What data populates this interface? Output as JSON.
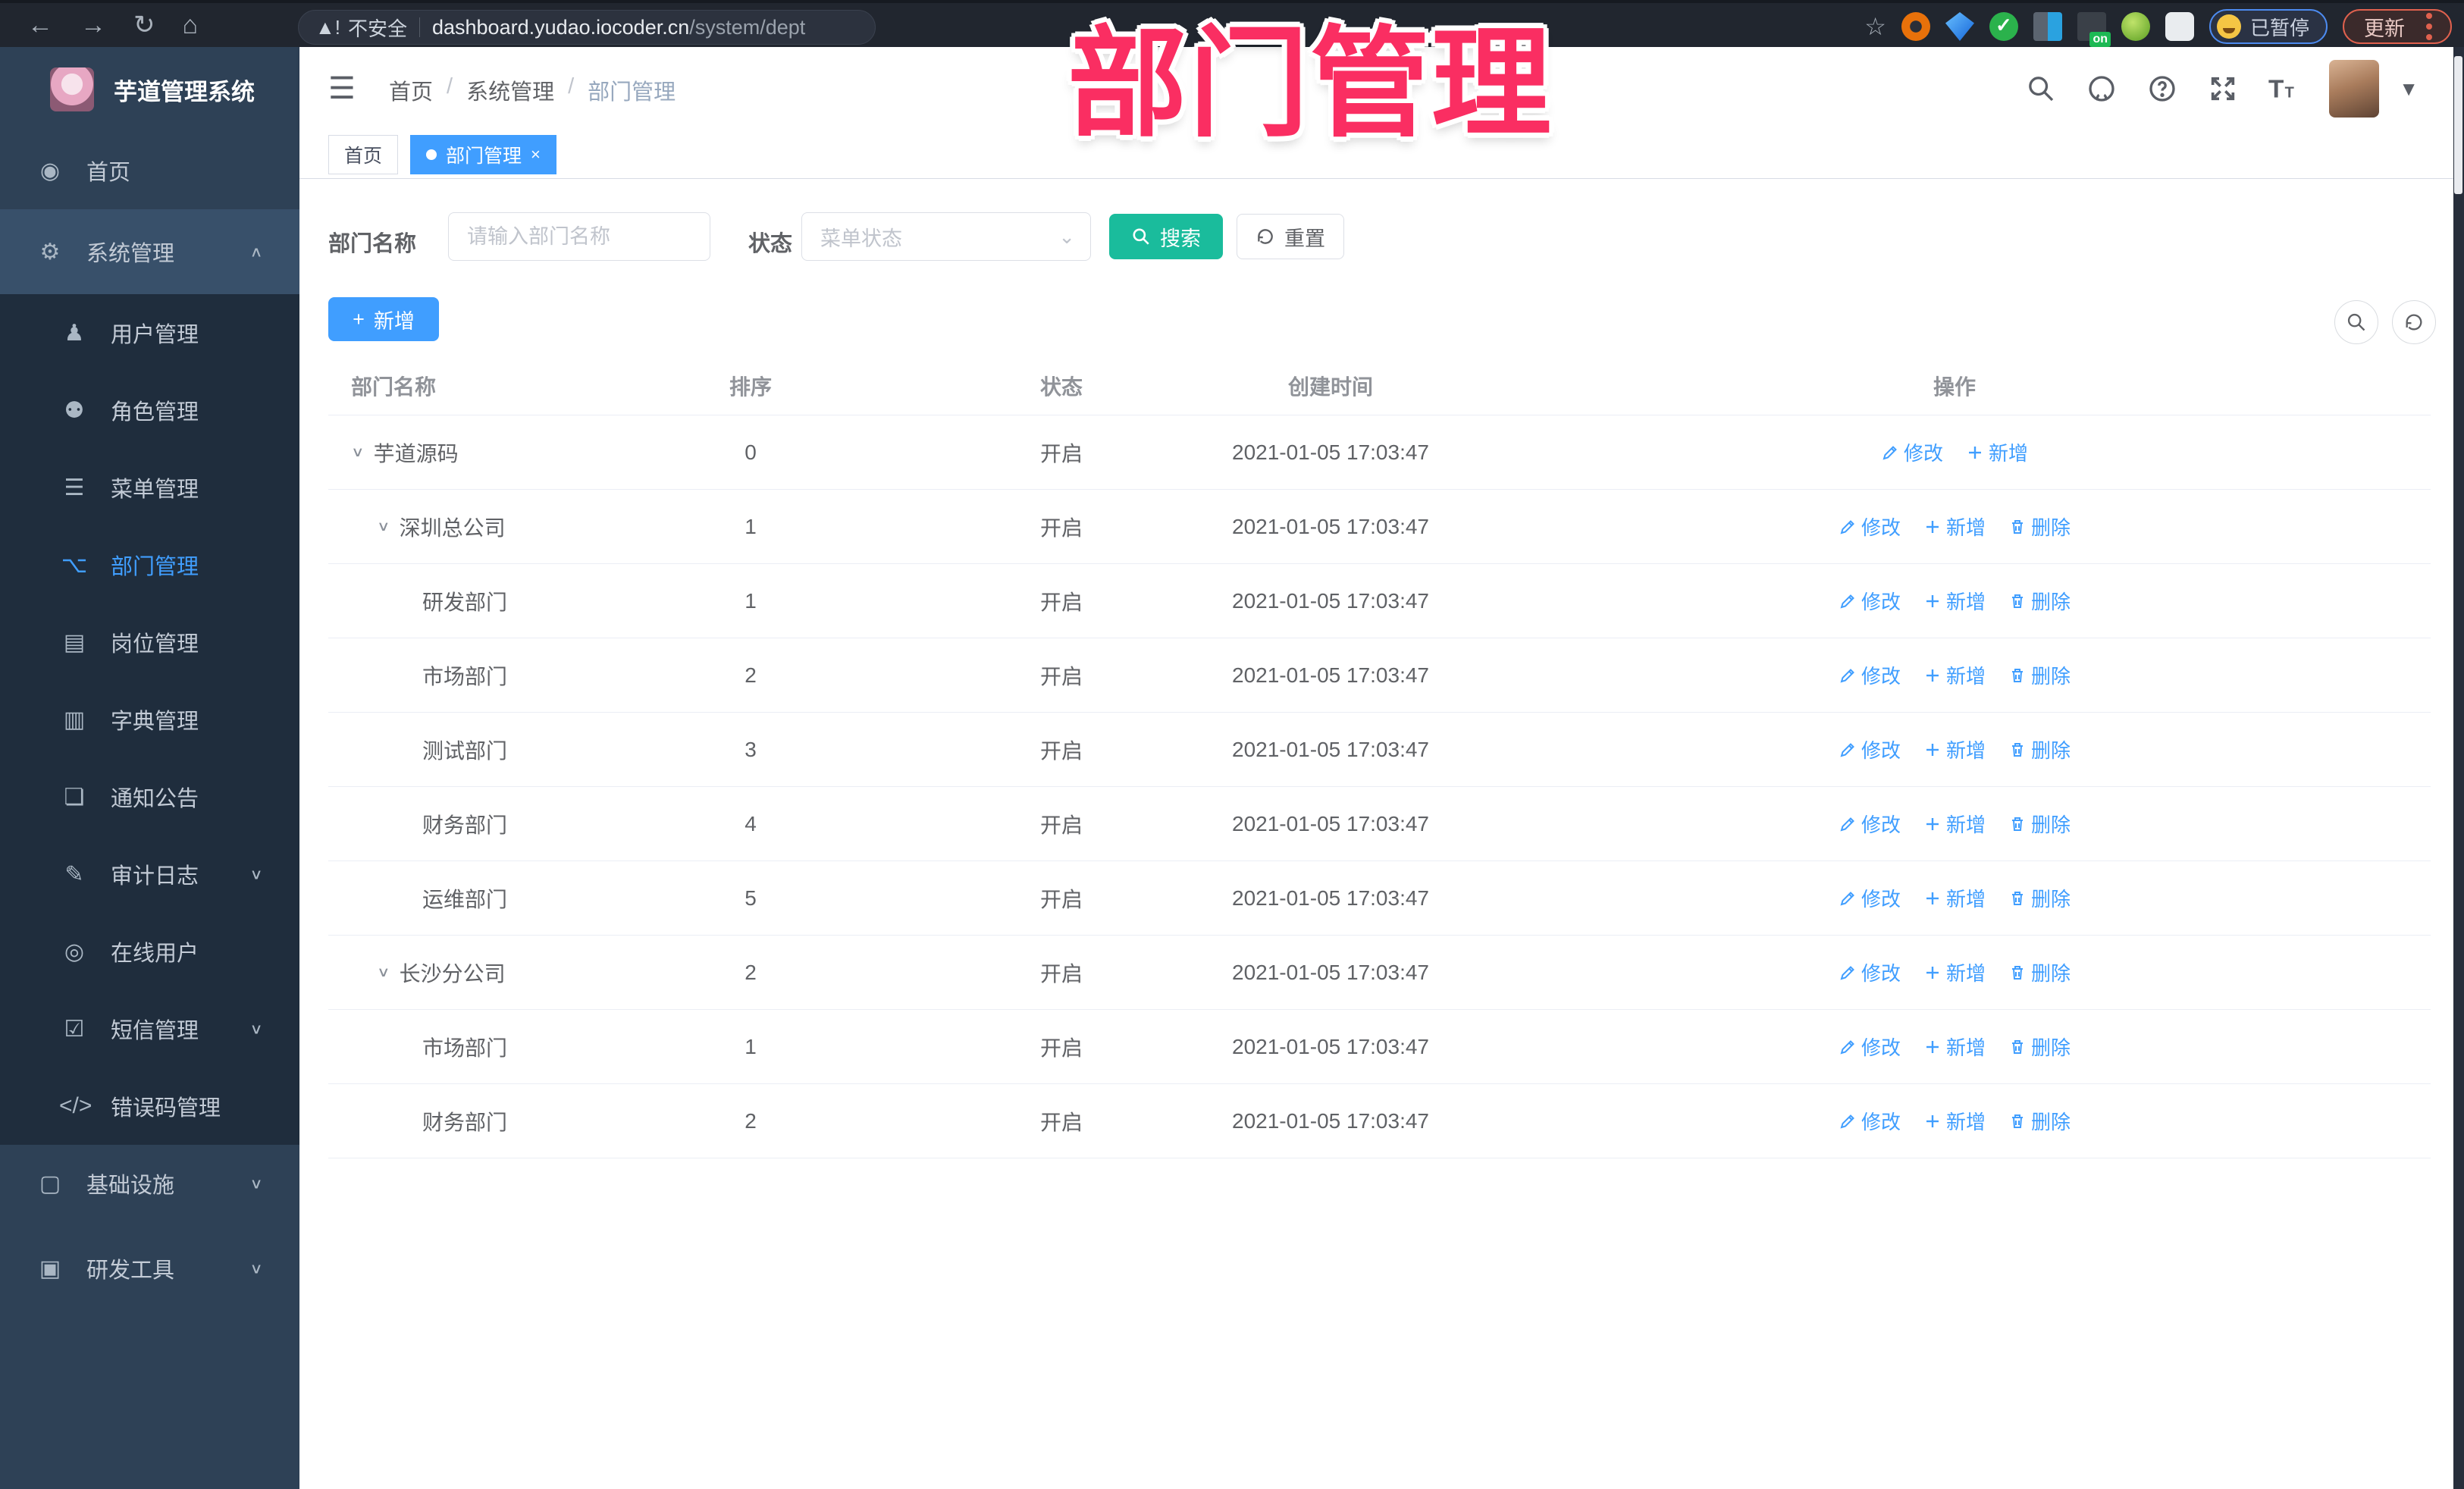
{
  "browser": {
    "back": "←",
    "forward": "→",
    "reload": "↻",
    "home": "⌂",
    "security_label": "不安全",
    "url_host": "dashboard.yudao.iocoder.cn",
    "url_path": "/system/dept",
    "star": "☆",
    "extension_badge": "on",
    "paused_label": "已暂停",
    "update_label": "更新"
  },
  "overlay_title": "部门管理",
  "sidebar": {
    "logo_title": "芋道管理系统",
    "items": [
      {
        "label": "首页",
        "icon": "dashboard-icon",
        "glyph": "◉",
        "kind": "top"
      },
      {
        "label": "系统管理",
        "icon": "gear-icon",
        "glyph": "⚙",
        "kind": "band",
        "chevron": "up"
      },
      {
        "label": "用户管理",
        "icon": "user-icon",
        "glyph": "♟",
        "kind": "sub"
      },
      {
        "label": "角色管理",
        "icon": "roles-icon",
        "glyph": "⚉",
        "kind": "sub"
      },
      {
        "label": "菜单管理",
        "icon": "menu-list-icon",
        "glyph": "☰",
        "kind": "sub"
      },
      {
        "label": "部门管理",
        "icon": "org-tree-icon",
        "glyph": "⌥",
        "kind": "sub",
        "active": true
      },
      {
        "label": "岗位管理",
        "icon": "post-icon",
        "glyph": "▤",
        "kind": "sub"
      },
      {
        "label": "字典管理",
        "icon": "dictionary-icon",
        "glyph": "▥",
        "kind": "sub"
      },
      {
        "label": "通知公告",
        "icon": "announcement-icon",
        "glyph": "❏",
        "kind": "sub"
      },
      {
        "label": "审计日志",
        "icon": "audit-log-icon",
        "glyph": "✎",
        "kind": "sub",
        "chevron": "down"
      },
      {
        "label": "在线用户",
        "icon": "online-users-icon",
        "glyph": "◎",
        "kind": "sub"
      },
      {
        "label": "短信管理",
        "icon": "sms-icon",
        "glyph": "☑",
        "kind": "sub",
        "chevron": "down"
      },
      {
        "label": "错误码管理",
        "icon": "error-code-icon",
        "glyph": "</>",
        "kind": "sub"
      },
      {
        "label": "基础设施",
        "icon": "infrastructure-icon",
        "glyph": "▢",
        "kind": "top",
        "chevron": "down"
      },
      {
        "label": "研发工具",
        "icon": "dev-tools-icon",
        "glyph": "▣",
        "kind": "top",
        "chevron": "down",
        "gap": true
      }
    ]
  },
  "header": {
    "breadcrumb": [
      "首页",
      "系统管理",
      "部门管理"
    ],
    "separator": "/"
  },
  "tags": [
    {
      "label": "首页",
      "active": false,
      "closable": false
    },
    {
      "label": "部门管理",
      "active": true,
      "closable": true
    }
  ],
  "filter": {
    "name_label": "部门名称",
    "name_placeholder": "请输入部门名称",
    "status_label": "状态",
    "status_placeholder": "菜单状态",
    "search_label": "搜索",
    "reset_label": "重置"
  },
  "toolbar": {
    "add_label": "新增"
  },
  "table": {
    "columns": [
      "部门名称",
      "排序",
      "状态",
      "创建时间",
      "操作"
    ],
    "action_labels": {
      "edit": "修改",
      "add": "新增",
      "delete": "删除"
    },
    "rows": [
      {
        "name": "芋道源码",
        "indent": 0,
        "expandable": true,
        "order": "0",
        "status": "开启",
        "created": "2021-01-05 17:03:47",
        "can_delete": false
      },
      {
        "name": "深圳总公司",
        "indent": 1,
        "expandable": true,
        "order": "1",
        "status": "开启",
        "created": "2021-01-05 17:03:47",
        "can_delete": true
      },
      {
        "name": "研发部门",
        "indent": 2,
        "expandable": false,
        "order": "1",
        "status": "开启",
        "created": "2021-01-05 17:03:47",
        "can_delete": true
      },
      {
        "name": "市场部门",
        "indent": 2,
        "expandable": false,
        "order": "2",
        "status": "开启",
        "created": "2021-01-05 17:03:47",
        "can_delete": true
      },
      {
        "name": "测试部门",
        "indent": 2,
        "expandable": false,
        "order": "3",
        "status": "开启",
        "created": "2021-01-05 17:03:47",
        "can_delete": true
      },
      {
        "name": "财务部门",
        "indent": 2,
        "expandable": false,
        "order": "4",
        "status": "开启",
        "created": "2021-01-05 17:03:47",
        "can_delete": true
      },
      {
        "name": "运维部门",
        "indent": 2,
        "expandable": false,
        "order": "5",
        "status": "开启",
        "created": "2021-01-05 17:03:47",
        "can_delete": true
      },
      {
        "name": "长沙分公司",
        "indent": 1,
        "expandable": true,
        "order": "2",
        "status": "开启",
        "created": "2021-01-05 17:03:47",
        "can_delete": true
      },
      {
        "name": "市场部门",
        "indent": 2,
        "expandable": false,
        "order": "1",
        "status": "开启",
        "created": "2021-01-05 17:03:47",
        "can_delete": true
      },
      {
        "name": "财务部门",
        "indent": 2,
        "expandable": false,
        "order": "2",
        "status": "开启",
        "created": "2021-01-05 17:03:47",
        "can_delete": true
      }
    ]
  },
  "colors": {
    "accent_blue": "#409EFF",
    "search_teal": "#1abc9c",
    "overlay_pink": "#fa2e62",
    "sidebar_bg": "#2e4156",
    "submenu_bg": "#1f2d3d"
  }
}
